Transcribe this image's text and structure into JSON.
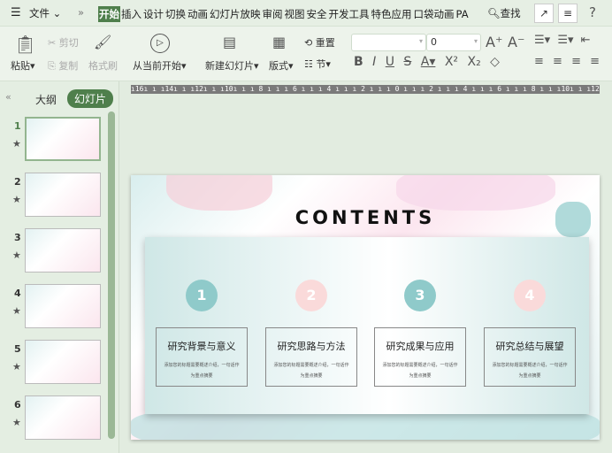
{
  "topbar": {
    "file": "文件",
    "more": "»",
    "tabs": [
      "开始",
      "插入",
      "设计",
      "切换",
      "动画",
      "幻灯片放映",
      "审阅",
      "视图",
      "安全",
      "开发工具",
      "特色应用",
      "口袋动画",
      "PA"
    ],
    "search": "查找",
    "help": "?"
  },
  "ribbon": {
    "paste": "粘贴",
    "cut": "剪切",
    "copy": "复制",
    "format_painter": "格式刷",
    "play_from_current": "从当前开始",
    "new_slide": "新建幻灯片",
    "layout": "版式",
    "reset": "重置",
    "section": "节",
    "font_name": "",
    "font_size": "0"
  },
  "ruler": "ı16ı ı ı14ı ı ı12ı ı ı10ı ı ı 8 ı ı ı 6 ı ı ı 4 ı ı ı 2 ı ı ı 0 ı ı ı 2 ı ı ı 4 ı ı ı 6 ı ı ı 8 ı ı ı10ı ı ı12ı ı ı14ı ı ı16ı",
  "panel": {
    "outline_tab": "大纲",
    "slides_tab": "幻灯片",
    "slides": [
      "1",
      "2",
      "3",
      "4",
      "5",
      "6"
    ]
  },
  "slide": {
    "title": "CONTENTS",
    "items": [
      {
        "num": "1",
        "title": "研究背景与意义",
        "desc": "添加您的标题需要概述介绍，一句话作为重点摘要",
        "color": "#8fcaca"
      },
      {
        "num": "2",
        "title": "研究思路与方法",
        "desc": "添加您的标题需要概述介绍，一句话作为重点摘要",
        "color": "#fadada"
      },
      {
        "num": "3",
        "title": "研究成果与应用",
        "desc": "添加您的标题需要概述介绍，一句话作为重点摘要",
        "color": "#8fcaca"
      },
      {
        "num": "4",
        "title": "研究总结与展望",
        "desc": "添加您的标题需要概述介绍，一句话作为重点摘要",
        "color": "#fadada"
      }
    ]
  }
}
